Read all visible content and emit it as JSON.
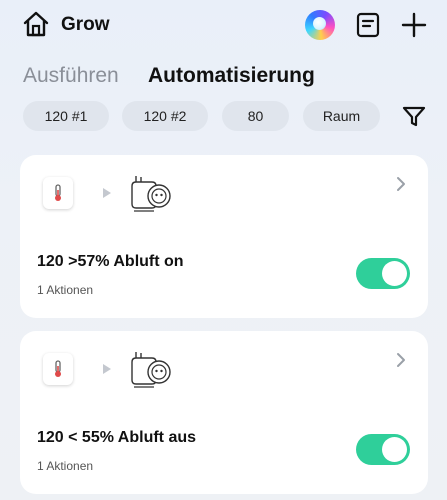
{
  "header": {
    "title": "Grow"
  },
  "tabs": [
    {
      "label": "Ausführen",
      "active": false
    },
    {
      "label": "Automatisierung",
      "active": true
    }
  ],
  "filters": [
    "120 #1",
    "120 #2",
    "80",
    "Raum"
  ],
  "automations": [
    {
      "title": "120 >57% Abluft on",
      "subtitle": "1 Aktionen",
      "enabled": true,
      "trigger_icon": "thermometer-icon",
      "action_icon": "smart-plug-icon"
    },
    {
      "title": "120 < 55% Abluft aus",
      "subtitle": "1 Aktionen",
      "enabled": true,
      "trigger_icon": "thermometer-icon",
      "action_icon": "smart-plug-icon"
    }
  ],
  "colors": {
    "toggle_on": "#2fcf9a",
    "card_bg": "#ffffff",
    "chip_bg": "#e0e5ed"
  }
}
